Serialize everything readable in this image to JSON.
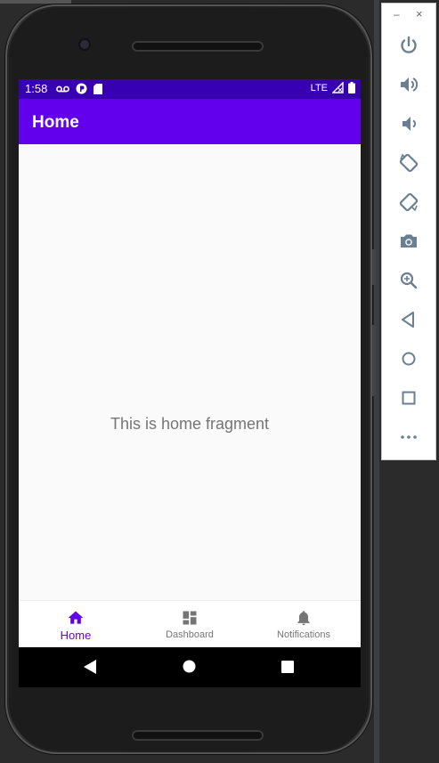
{
  "statusbar": {
    "time": "1:58",
    "network": "LTE"
  },
  "appbar": {
    "title": "Home"
  },
  "content": {
    "message": "This is home fragment"
  },
  "bottom_nav": {
    "items": [
      {
        "label": "Home",
        "icon": "home-icon",
        "active": true
      },
      {
        "label": "Dashboard",
        "icon": "dashboard-icon",
        "active": false
      },
      {
        "label": "Notifications",
        "icon": "bell-icon",
        "active": false
      }
    ]
  },
  "panel": {
    "minimize": "–",
    "close": "×",
    "buttons": [
      "power-icon",
      "volume-up-icon",
      "volume-down-icon",
      "rotate-left-icon",
      "rotate-right-icon",
      "camera-icon",
      "zoom-icon",
      "back-icon",
      "home-circle-icon",
      "overview-square-icon",
      "more-icon"
    ]
  },
  "colors": {
    "status_bar": "#3700b3",
    "app_bar": "#6200ee",
    "active": "#6200ee",
    "inactive": "#757575"
  }
}
